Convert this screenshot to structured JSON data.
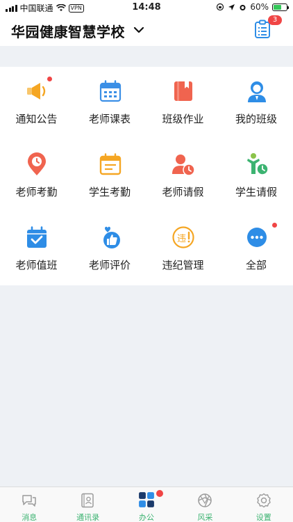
{
  "status_bar": {
    "carrier": "中国联通",
    "vpn": "VPN",
    "time": "14:48",
    "battery": "60%",
    "battery_level": 0.6
  },
  "header": {
    "title": "华园健康智慧学校",
    "task_badge": "3"
  },
  "grid": [
    {
      "label": "通知公告",
      "icon": "megaphone-icon",
      "color": "#f5a623",
      "dot": true
    },
    {
      "label": "老师课表",
      "icon": "calendar-icon",
      "color": "#3b8fe6",
      "dot": false
    },
    {
      "label": "班级作业",
      "icon": "homework-book-icon",
      "color": "#f0644f",
      "dot": false
    },
    {
      "label": "我的班级",
      "icon": "class-person-icon",
      "color": "#2e8de6",
      "dot": false
    },
    {
      "label": "老师考勤",
      "icon": "location-clock-icon",
      "color": "#f0644f",
      "dot": false
    },
    {
      "label": "学生考勤",
      "icon": "clipboard-icon",
      "color": "#f5a623",
      "dot": false
    },
    {
      "label": "老师请假",
      "icon": "teacher-leave-icon",
      "color": "#f0644f",
      "dot": false
    },
    {
      "label": "学生请假",
      "icon": "student-leave-icon",
      "color": "#3cb371",
      "dot": false
    },
    {
      "label": "老师值班",
      "icon": "calendar-check-icon",
      "color": "#2e8de6",
      "dot": false
    },
    {
      "label": "老师评价",
      "icon": "thumbs-up-icon",
      "color": "#2e8de6",
      "dot": false
    },
    {
      "label": "违纪管理",
      "icon": "violation-icon",
      "color": "#f5a623",
      "dot": false
    },
    {
      "label": "全部",
      "icon": "more-dots-icon",
      "color": "#2e8de6",
      "dot": true
    }
  ],
  "tabs": [
    {
      "label": "消息",
      "icon": "message-icon",
      "active": false
    },
    {
      "label": "通讯录",
      "icon": "contacts-icon",
      "active": false
    },
    {
      "label": "办公",
      "icon": "office-grid-icon",
      "active": true
    },
    {
      "label": "风采",
      "icon": "gallery-icon",
      "active": false
    },
    {
      "label": "设置",
      "icon": "settings-icon",
      "active": false
    }
  ],
  "colors": {
    "accent": "#3cb371",
    "badge": "#f04545",
    "background": "#eef1f5"
  }
}
